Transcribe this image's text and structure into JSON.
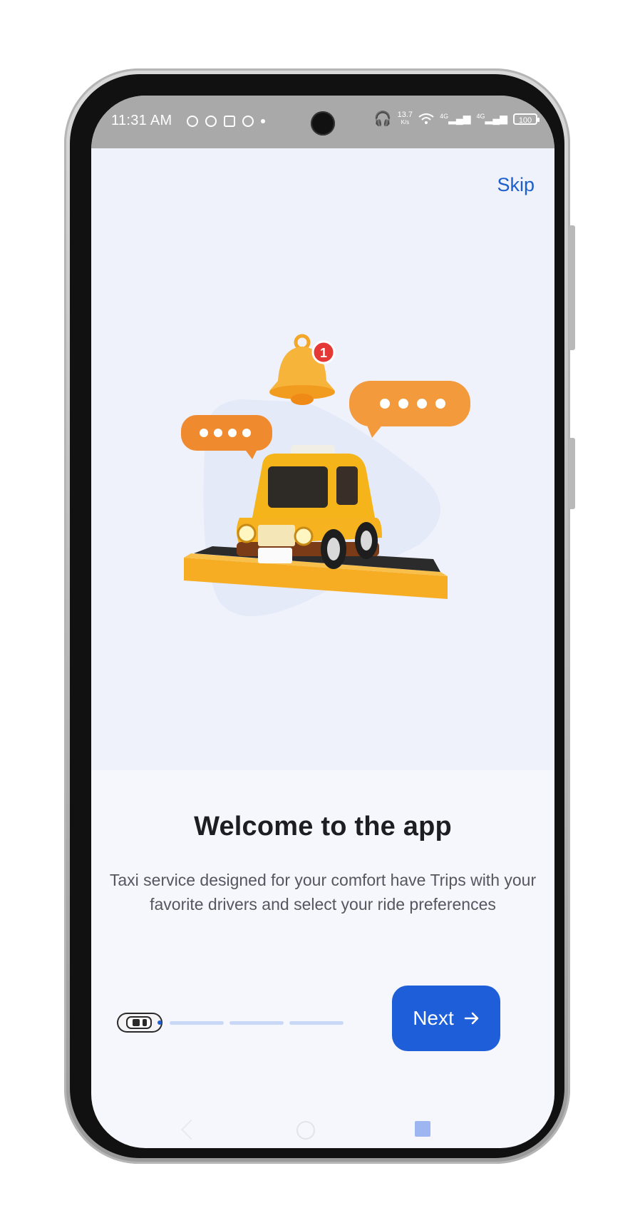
{
  "status_bar": {
    "time": "11:31 AM",
    "speed": "13.7",
    "speed_unit": "K/s",
    "network_1": "4G",
    "network_2": "4G",
    "battery": "100"
  },
  "header": {
    "skip_label": "Skip"
  },
  "illustration": {
    "notification_count": "1",
    "taxi_color": "#f4b41a",
    "bubble_color": "#f39a3c",
    "bell_color": "#f6b43a",
    "badge_color": "#e53935"
  },
  "onboarding": {
    "title": "Welcome to the app",
    "description": "Taxi service designed for your comfort have Trips with your favorite drivers and select your ride preferences",
    "page": 1,
    "page_count": 4
  },
  "actions": {
    "next_label": "Next",
    "next_icon": "arrow-right-icon"
  },
  "colors": {
    "accent": "#1e5ed8",
    "skip_link": "#1b5fcb",
    "progress_track": "#c8d8f6"
  }
}
